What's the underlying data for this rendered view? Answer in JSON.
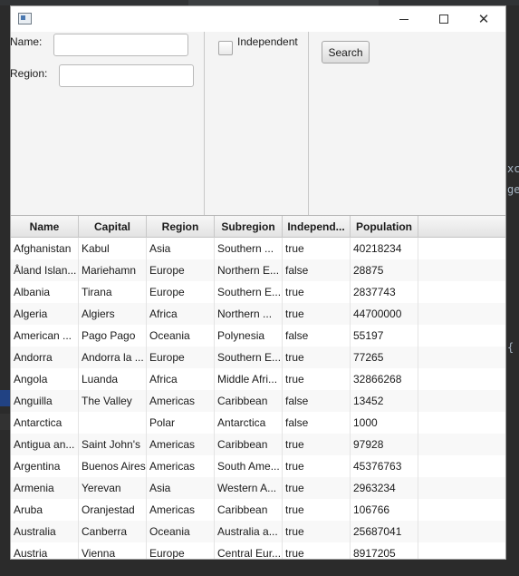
{
  "background_ide": {
    "side_text_1": "xc",
    "side_text_2": "ge",
    "side_text_3": "{"
  },
  "titlebar": {
    "minimize": "minimize",
    "maximize": "maximize",
    "close": "✕"
  },
  "form": {
    "name_label": "Name:",
    "name_value": "",
    "region_label": "Region:",
    "region_value": "",
    "independent_label": "Independent",
    "independent_checked": false,
    "search_label": "Search"
  },
  "table": {
    "columns": [
      "Name",
      "Capital",
      "Region",
      "Subregion",
      "Independ...",
      "Population",
      ""
    ],
    "rows": [
      [
        "Afghanistan",
        "Kabul",
        "Asia",
        "Southern ...",
        "true",
        "40218234"
      ],
      [
        "Åland Islan...",
        "Mariehamn",
        "Europe",
        "Northern E...",
        "false",
        "28875"
      ],
      [
        "Albania",
        "Tirana",
        "Europe",
        "Southern E...",
        "true",
        "2837743"
      ],
      [
        "Algeria",
        "Algiers",
        "Africa",
        "Northern ...",
        "true",
        "44700000"
      ],
      [
        "American ...",
        "Pago Pago",
        "Oceania",
        "Polynesia",
        "false",
        "55197"
      ],
      [
        "Andorra",
        "Andorra la ...",
        "Europe",
        "Southern E...",
        "true",
        "77265"
      ],
      [
        "Angola",
        "Luanda",
        "Africa",
        "Middle Afri...",
        "true",
        "32866268"
      ],
      [
        "Anguilla",
        "The Valley",
        "Americas",
        "Caribbean",
        "false",
        "13452"
      ],
      [
        "Antarctica",
        "",
        "Polar",
        "Antarctica",
        "false",
        "1000"
      ],
      [
        "Antigua an...",
        "Saint John's",
        "Americas",
        "Caribbean",
        "true",
        "97928"
      ],
      [
        "Argentina",
        "Buenos Aires",
        "Americas",
        "South Ame...",
        "true",
        "45376763"
      ],
      [
        "Armenia",
        "Yerevan",
        "Asia",
        "Western A...",
        "true",
        "2963234"
      ],
      [
        "Aruba",
        "Oranjestad",
        "Americas",
        "Caribbean",
        "true",
        "106766"
      ],
      [
        "Australia",
        "Canberra",
        "Oceania",
        "Australia a...",
        "true",
        "25687041"
      ],
      [
        "Austria",
        "Vienna",
        "Europe",
        "Central Eur...",
        "true",
        "8917205"
      ]
    ]
  }
}
